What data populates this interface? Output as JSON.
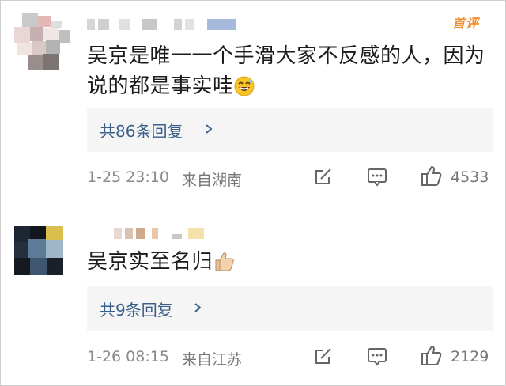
{
  "comments": [
    {
      "hot_badge": "首评",
      "text_line1": "吴京是唯一一个手滑大家不反感的人，因为",
      "text_line2": "说的都是事实哇",
      "emoji": "grinning-sweat-emoji",
      "replies_label": "共86条回复",
      "time": "1-25 23:10",
      "location": "来自湖南",
      "like_count": "4533"
    },
    {
      "text": "吴京实至名归",
      "emoji": "thumbs-up-emoji",
      "replies_label": "共9条回复",
      "time": "1-26 08:15",
      "location": "来自江苏",
      "like_count": "2129"
    }
  ],
  "icons": {
    "share": "share-icon",
    "comment": "comment-icon",
    "like": "like-icon",
    "chevron": "chevron-right-icon"
  },
  "colors": {
    "link": "#3a5f8a",
    "badge": "#f28c2c",
    "meta": "#8a8a8a",
    "reply_bg": "#f5f5f5"
  }
}
